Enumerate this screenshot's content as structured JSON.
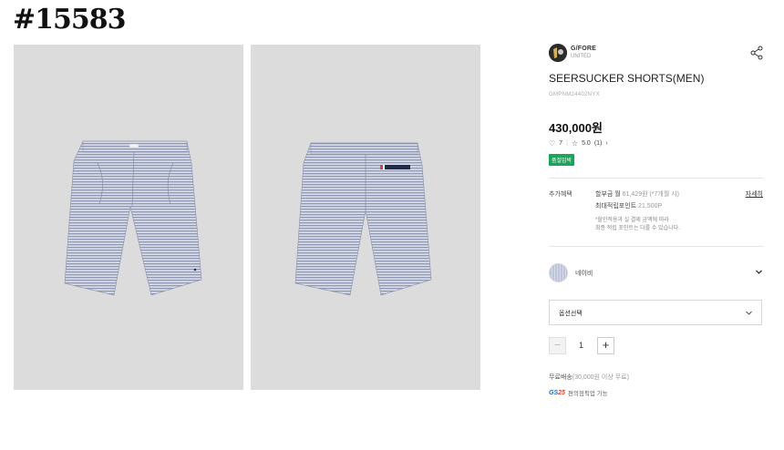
{
  "tag": "#15583",
  "product": {
    "brand_name": "G/FORE",
    "brand_sub": "UNITED",
    "title": "SEERSUCKER SHORTS(MEN)",
    "code": "GMPNM24402NYX",
    "price": "430,000원",
    "likes": "7",
    "rating": "5.0",
    "reviews": "(1)",
    "badge": "품절임박"
  },
  "benefit": {
    "label": "추가혜택",
    "installment_prefix": "할부금 월",
    "installment_value": "61,429원 (*7개월 시)",
    "more": "자세히",
    "points_label": "최대적립포인트",
    "points_value": "21,500P",
    "note1": "*할인적용과 실 결제 금액에 따라",
    "note2": "최종 적립 포인트는 다를 수 있습니다."
  },
  "color": {
    "name": "네이비",
    "swatch": "#a8b0c8"
  },
  "option": {
    "placeholder": "옵션선택"
  },
  "quantity": {
    "minus": "−",
    "value": "1",
    "plus": "+"
  },
  "shipping": {
    "label": "무료배송",
    "detail": "(30,000원 이상 무료)",
    "gs_logo_g": "GS",
    "gs_logo_n": "25",
    "gs_text": "편의점픽업 기능"
  },
  "icons": {
    "share": "share-icon",
    "heart": "heart-icon",
    "star": "star-icon",
    "chevron": "chevron-down-icon"
  }
}
